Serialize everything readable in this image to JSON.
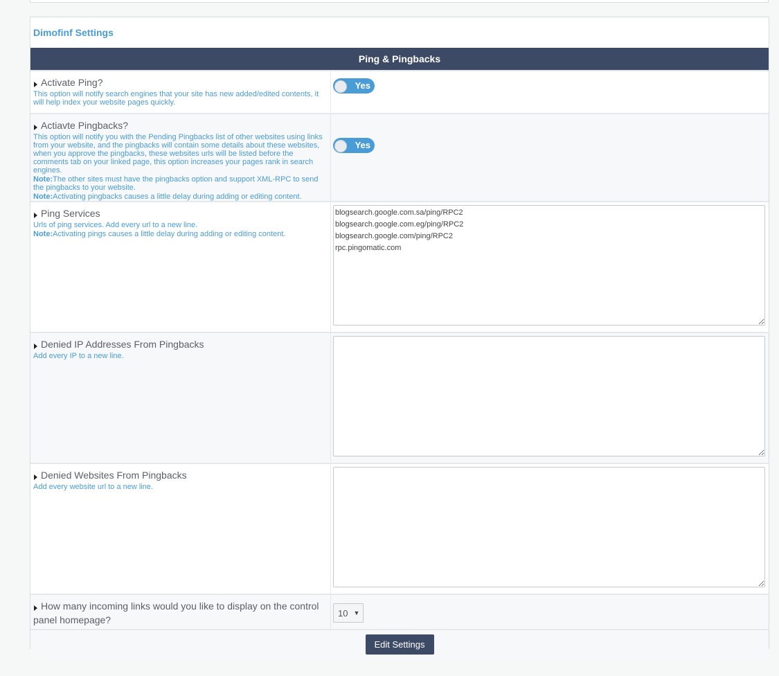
{
  "panel": {
    "title": "Dimofinf Settings",
    "section_header": "Ping & Pingbacks"
  },
  "options": {
    "activate_ping": {
      "title": "Activate Ping?",
      "description": "This option will notify search engines that your site has new added/edited contents, it will help index your website pages quickly.",
      "toggle_label": "Yes"
    },
    "activate_pingbacks": {
      "title": "Actiavte Pingbacks?",
      "description": "This option will notify you with the Pending Pingbacks list of other websites using links from your website, and the pingbacks will contain some details about these websites, when you approve the pingbacks, these websites urls will be listed before the comments tab on your linked page, this option increases your pages rank in search engines.",
      "note1_label": "Note:",
      "note1_text": "The other sites must have the pingbacks option and support XML-RPC to send the pingbacks to your website.",
      "note2_label": "Note:",
      "note2_text": "Activating pingbacks causes a little delay during adding or editing content.",
      "toggle_label": "Yes"
    },
    "ping_services": {
      "title": "Ping Services",
      "description": "Urls of ping services. Add every url to a new line.",
      "note_label": "Note:",
      "note_text": "Activating pings causes a little delay during adding or editing content.",
      "value": "blogsearch.google.com.sa/ping/RPC2\nblogsearch.google.com.eg/ping/RPC2\nblogsearch.google.com/ping/RPC2\nrpc.pingomatic.com"
    },
    "denied_ips": {
      "title": "Denied IP Addresses From Pingbacks",
      "description": "Add every IP to a new line.",
      "value": ""
    },
    "denied_websites": {
      "title": "Denied Websites From Pingbacks",
      "description": "Add every website url to a new line.",
      "value": ""
    },
    "incoming_links": {
      "title": "How many incoming links would you like to display on the control panel homepage?",
      "selected": "10"
    }
  },
  "footer": {
    "submit_label": "Edit Settings"
  },
  "colors": {
    "accent": "#4a9cd6",
    "header_bg": "#3d4a65"
  }
}
